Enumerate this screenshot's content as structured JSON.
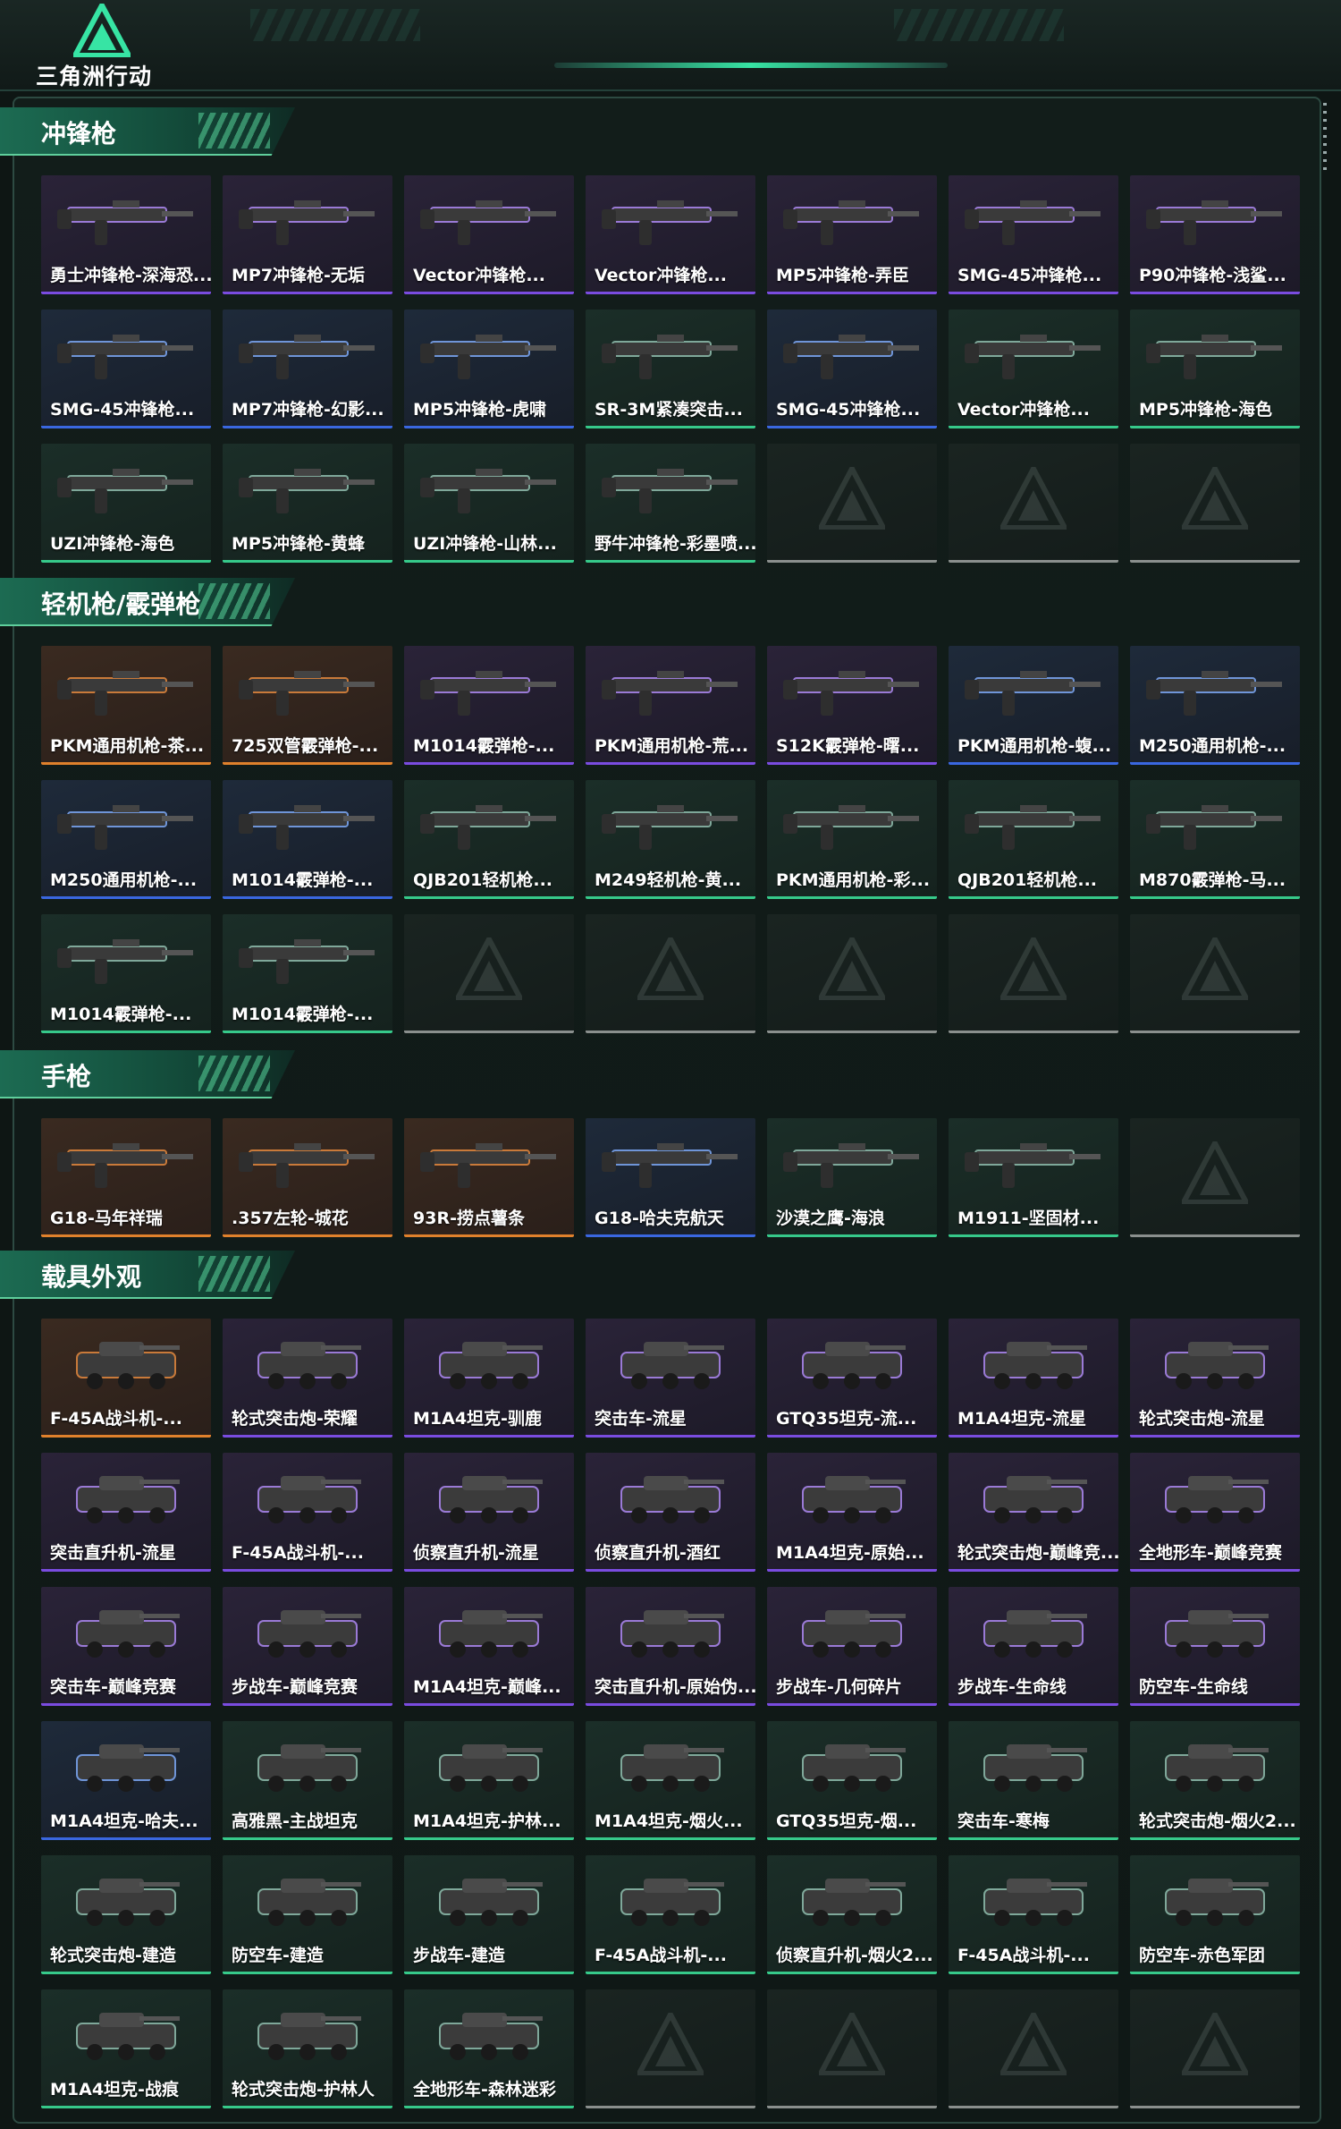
{
  "app": {
    "title": "三角洲行动"
  },
  "colors": {
    "gold": "#e0812c",
    "purple": "#7a4ce0",
    "blue": "#3a67e0",
    "green": "#36c98a",
    "empty": "#8a8f8d",
    "accent": "#37e4a4"
  },
  "sections": [
    {
      "title": "冲锋枪",
      "items": [
        {
          "label": "勇士冲锋枪-深海恐...",
          "rarity": "purple"
        },
        {
          "label": "MP7冲锋枪-无垢",
          "rarity": "purple"
        },
        {
          "label": "Vector冲锋枪...",
          "rarity": "purple"
        },
        {
          "label": "Vector冲锋枪...",
          "rarity": "purple"
        },
        {
          "label": "MP5冲锋枪-弄臣",
          "rarity": "purple"
        },
        {
          "label": "SMG-45冲锋枪...",
          "rarity": "purple"
        },
        {
          "label": "P90冲锋枪-浅鲨...",
          "rarity": "purple"
        },
        {
          "label": "SMG-45冲锋枪...",
          "rarity": "blue"
        },
        {
          "label": "MP7冲锋枪-幻影...",
          "rarity": "blue"
        },
        {
          "label": "MP5冲锋枪-虎啸",
          "rarity": "blue"
        },
        {
          "label": "SR-3M紧凑突击...",
          "rarity": "green"
        },
        {
          "label": "SMG-45冲锋枪...",
          "rarity": "blue"
        },
        {
          "label": "Vector冲锋枪...",
          "rarity": "green"
        },
        {
          "label": "MP5冲锋枪-海色",
          "rarity": "green"
        },
        {
          "label": "UZI冲锋枪-海色",
          "rarity": "green"
        },
        {
          "label": "MP5冲锋枪-黄蜂",
          "rarity": "green"
        },
        {
          "label": "UZI冲锋枪-山林...",
          "rarity": "green"
        },
        {
          "label": "野牛冲锋枪-彩墨喷...",
          "rarity": "green"
        },
        {
          "label": "",
          "rarity": "empty"
        },
        {
          "label": "",
          "rarity": "empty"
        },
        {
          "label": "",
          "rarity": "empty"
        }
      ]
    },
    {
      "title": "轻机枪/霰弹枪",
      "items": [
        {
          "label": "PKM通用机枪-茶...",
          "rarity": "gold"
        },
        {
          "label": "725双管霰弹枪-...",
          "rarity": "gold"
        },
        {
          "label": "M1014霰弹枪-...",
          "rarity": "purple"
        },
        {
          "label": "PKM通用机枪-荒...",
          "rarity": "purple"
        },
        {
          "label": "S12K霰弹枪-曙...",
          "rarity": "purple"
        },
        {
          "label": "PKM通用机枪-蝮...",
          "rarity": "blue"
        },
        {
          "label": "M250通用机枪-...",
          "rarity": "blue"
        },
        {
          "label": "M250通用机枪-...",
          "rarity": "blue"
        },
        {
          "label": "M1014霰弹枪-...",
          "rarity": "blue"
        },
        {
          "label": "QJB201轻机枪...",
          "rarity": "green"
        },
        {
          "label": "M249轻机枪-黄...",
          "rarity": "green"
        },
        {
          "label": "PKM通用机枪-彩...",
          "rarity": "green"
        },
        {
          "label": "QJB201轻机枪...",
          "rarity": "green"
        },
        {
          "label": "M870霰弹枪-马...",
          "rarity": "green"
        },
        {
          "label": "M1014霰弹枪-...",
          "rarity": "green"
        },
        {
          "label": "M1014霰弹枪-...",
          "rarity": "green"
        },
        {
          "label": "",
          "rarity": "empty"
        },
        {
          "label": "",
          "rarity": "empty"
        },
        {
          "label": "",
          "rarity": "empty"
        },
        {
          "label": "",
          "rarity": "empty"
        },
        {
          "label": "",
          "rarity": "empty"
        }
      ]
    },
    {
      "title": "手枪",
      "items": [
        {
          "label": "G18-马年祥瑞",
          "rarity": "gold"
        },
        {
          "label": ".357左轮-城花",
          "rarity": "gold"
        },
        {
          "label": "93R-捞点薯条",
          "rarity": "gold"
        },
        {
          "label": "G18-哈夫克航天",
          "rarity": "blue"
        },
        {
          "label": "沙漠之鹰-海浪",
          "rarity": "green"
        },
        {
          "label": "M1911-坚固材...",
          "rarity": "green"
        },
        {
          "label": "",
          "rarity": "empty"
        }
      ]
    },
    {
      "title": "载具外观",
      "items": [
        {
          "label": "F-45A战斗机-...",
          "rarity": "gold"
        },
        {
          "label": "轮式突击炮-荣耀",
          "rarity": "purple"
        },
        {
          "label": "M1A4坦克-驯鹿",
          "rarity": "purple"
        },
        {
          "label": "突击车-流星",
          "rarity": "purple"
        },
        {
          "label": "GTQ35坦克-流...",
          "rarity": "purple"
        },
        {
          "label": "M1A4坦克-流星",
          "rarity": "purple"
        },
        {
          "label": "轮式突击炮-流星",
          "rarity": "purple"
        },
        {
          "label": "突击直升机-流星",
          "rarity": "purple"
        },
        {
          "label": "F-45A战斗机-...",
          "rarity": "purple"
        },
        {
          "label": "侦察直升机-流星",
          "rarity": "purple"
        },
        {
          "label": "侦察直升机-酒红",
          "rarity": "purple"
        },
        {
          "label": "M1A4坦克-原始...",
          "rarity": "purple"
        },
        {
          "label": "轮式突击炮-巅峰竞...",
          "rarity": "purple"
        },
        {
          "label": "全地形车-巅峰竞赛",
          "rarity": "purple"
        },
        {
          "label": "突击车-巅峰竞赛",
          "rarity": "purple"
        },
        {
          "label": "步战车-巅峰竞赛",
          "rarity": "purple"
        },
        {
          "label": "M1A4坦克-巅峰...",
          "rarity": "purple"
        },
        {
          "label": "突击直升机-原始伪...",
          "rarity": "purple"
        },
        {
          "label": "步战车-几何碎片",
          "rarity": "purple"
        },
        {
          "label": "步战车-生命线",
          "rarity": "purple"
        },
        {
          "label": "防空车-生命线",
          "rarity": "purple"
        },
        {
          "label": "M1A4坦克-哈夫...",
          "rarity": "blue"
        },
        {
          "label": "高雅黑-主战坦克",
          "rarity": "green"
        },
        {
          "label": "M1A4坦克-护林...",
          "rarity": "green"
        },
        {
          "label": "M1A4坦克-烟火...",
          "rarity": "green"
        },
        {
          "label": "GTQ35坦克-烟...",
          "rarity": "green"
        },
        {
          "label": "突击车-寒梅",
          "rarity": "green"
        },
        {
          "label": "轮式突击炮-烟火2...",
          "rarity": "green"
        },
        {
          "label": "轮式突击炮-建造",
          "rarity": "green"
        },
        {
          "label": "防空车-建造",
          "rarity": "green"
        },
        {
          "label": "步战车-建造",
          "rarity": "green"
        },
        {
          "label": "F-45A战斗机-...",
          "rarity": "green"
        },
        {
          "label": "侦察直升机-烟火2...",
          "rarity": "green"
        },
        {
          "label": "F-45A战斗机-...",
          "rarity": "green"
        },
        {
          "label": "防空车-赤色军团",
          "rarity": "green"
        },
        {
          "label": "M1A4坦克-战痕",
          "rarity": "green"
        },
        {
          "label": "轮式突击炮-护林人",
          "rarity": "green"
        },
        {
          "label": "全地形车-森林迷彩",
          "rarity": "green"
        },
        {
          "label": "",
          "rarity": "empty"
        },
        {
          "label": "",
          "rarity": "empty"
        },
        {
          "label": "",
          "rarity": "empty"
        },
        {
          "label": "",
          "rarity": "empty"
        }
      ]
    }
  ]
}
